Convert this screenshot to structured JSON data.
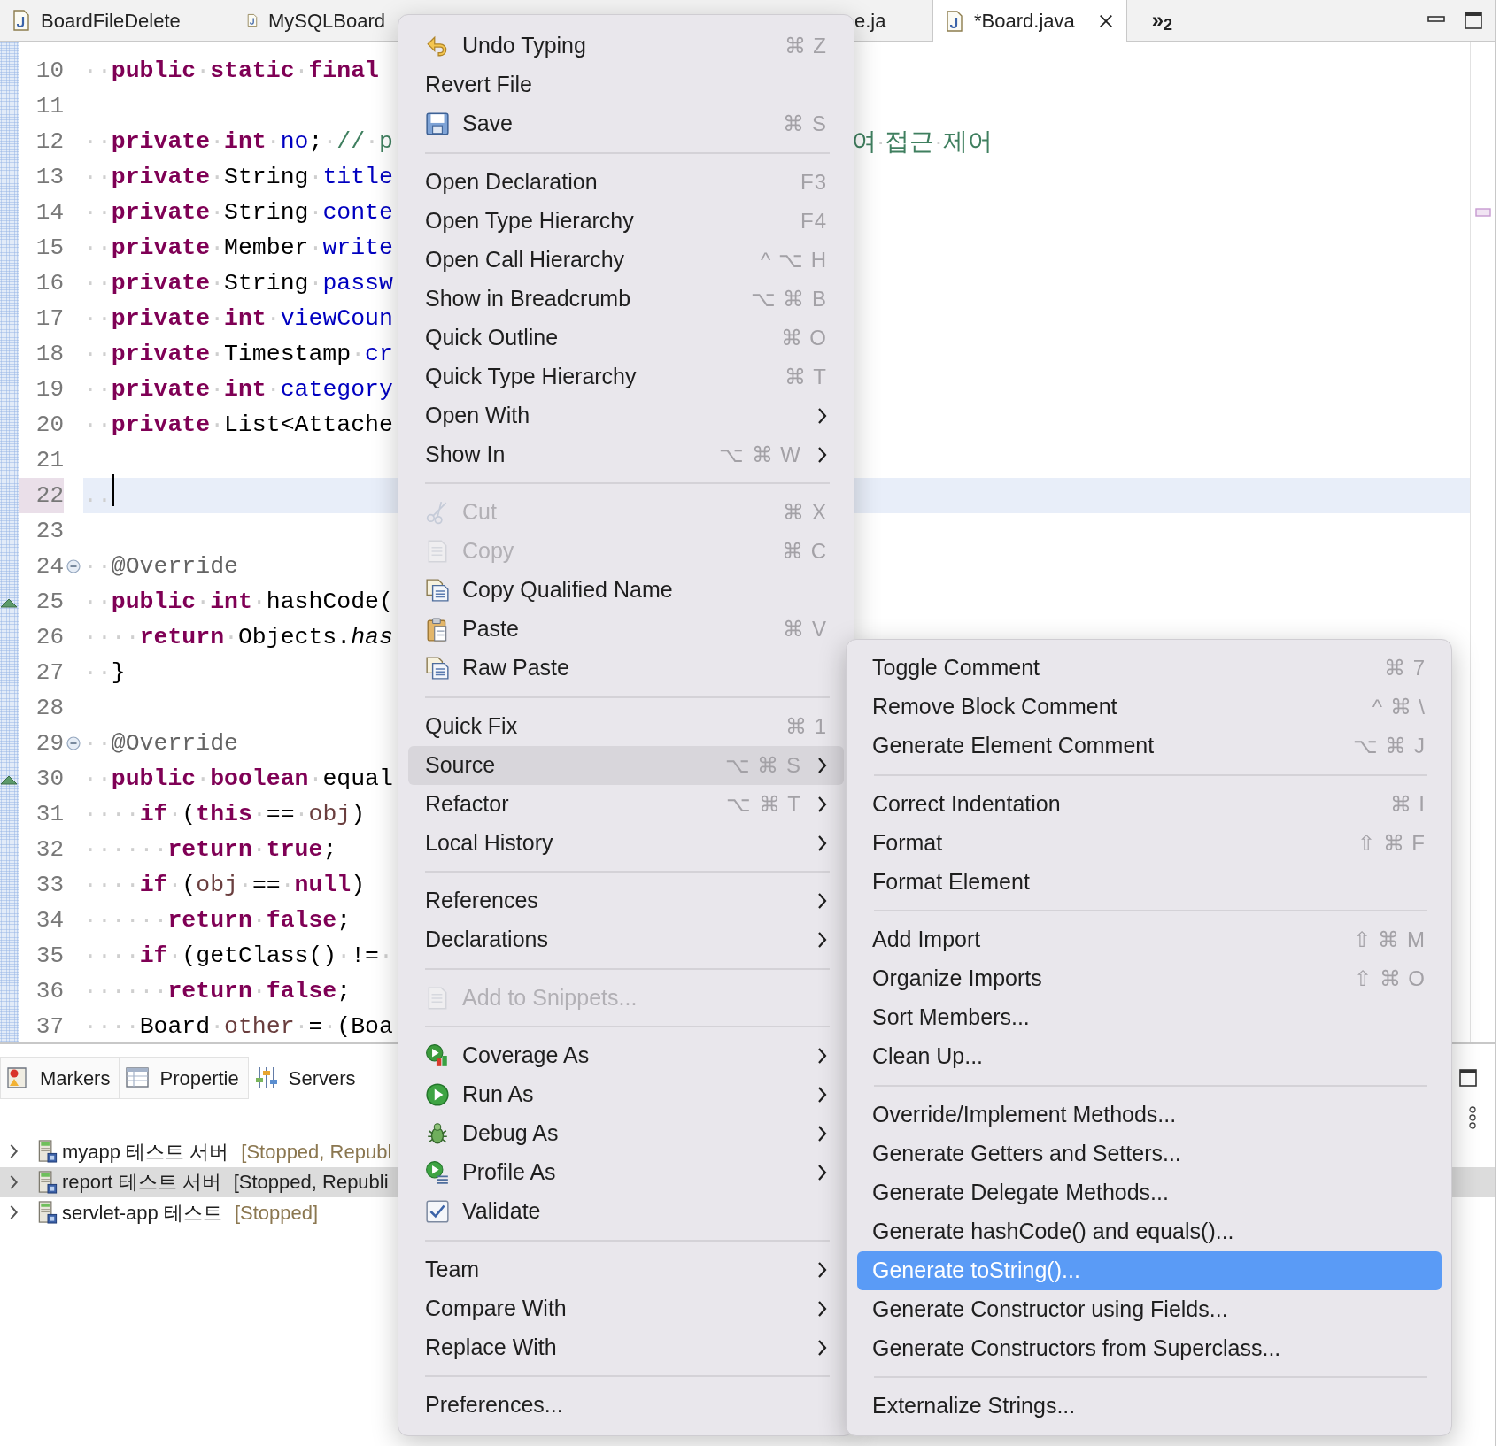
{
  "editor_tabs": [
    {
      "label": "BoardFileDelete",
      "selected": false
    },
    {
      "label": "MySQLBoard",
      "selected": false
    },
    {
      "label": "e.ja",
      "selected": false
    },
    {
      "label": "*Board.java",
      "selected": true
    }
  ],
  "tab_overflow": "»$_{2}$",
  "code_lines": [
    {
      "n": "10",
      "current": false,
      "fold": false,
      "override": false,
      "code": [
        {
          "kind": "kw",
          "text": "··public·static·final"
        }
      ]
    },
    {
      "n": "11",
      "current": false,
      "fold": false,
      "override": false
    },
    {
      "n": "12",
      "current": false,
      "fold": false,
      "override": false,
      "code": [
        {
          "kind": "kw",
          "text": "··private·int·"
        },
        {
          "kind": "field",
          "text": "no"
        },
        {
          "kind": "plain",
          "text": ";·"
        },
        {
          "kind": "comment",
          "text": "//·p"
        }
      ],
      "tail": "여·접근·제어"
    },
    {
      "n": "13",
      "current": false,
      "fold": false,
      "override": false,
      "code": [
        {
          "kind": "kw",
          "text": "··private·"
        },
        {
          "kind": "plain",
          "text": "String·"
        },
        {
          "kind": "field",
          "text": "title"
        }
      ]
    },
    {
      "n": "14",
      "current": false,
      "fold": false,
      "override": false,
      "code": [
        {
          "kind": "kw",
          "text": "··private·"
        },
        {
          "kind": "plain",
          "text": "String·"
        },
        {
          "kind": "field",
          "text": "conte"
        }
      ]
    },
    {
      "n": "15",
      "current": false,
      "fold": false,
      "override": false,
      "code": [
        {
          "kind": "kw",
          "text": "··private·"
        },
        {
          "kind": "plain",
          "text": "Member·"
        },
        {
          "kind": "field",
          "text": "write"
        }
      ]
    },
    {
      "n": "16",
      "current": false,
      "fold": false,
      "override": false,
      "code": [
        {
          "kind": "kw",
          "text": "··private·"
        },
        {
          "kind": "plain",
          "text": "String·"
        },
        {
          "kind": "field",
          "text": "passw"
        }
      ]
    },
    {
      "n": "17",
      "current": false,
      "fold": false,
      "override": false,
      "code": [
        {
          "kind": "kw",
          "text": "··private·int·"
        },
        {
          "kind": "field",
          "text": "viewCoun"
        }
      ]
    },
    {
      "n": "18",
      "current": false,
      "fold": false,
      "override": false,
      "code": [
        {
          "kind": "kw",
          "text": "··private·"
        },
        {
          "kind": "plain",
          "text": "Timestamp·"
        },
        {
          "kind": "field",
          "text": "cr"
        }
      ]
    },
    {
      "n": "19",
      "current": false,
      "fold": false,
      "override": false,
      "code": [
        {
          "kind": "kw",
          "text": "··private·int·"
        },
        {
          "kind": "field",
          "text": "category"
        }
      ]
    },
    {
      "n": "20",
      "current": false,
      "fold": false,
      "override": false,
      "code": [
        {
          "kind": "kw",
          "text": "··private·"
        },
        {
          "kind": "plain",
          "text": "List<Attache"
        }
      ]
    },
    {
      "n": "21",
      "current": false,
      "fold": false,
      "override": false
    },
    {
      "n": "22",
      "current": true,
      "fold": false,
      "override": false,
      "code": [
        {
          "kind": "plain",
          "text": "··"
        }
      ]
    },
    {
      "n": "23",
      "current": false,
      "fold": false,
      "override": false
    },
    {
      "n": "24",
      "current": false,
      "fold": true,
      "override": false,
      "code": [
        {
          "kind": "annotation",
          "text": "··@Override"
        }
      ]
    },
    {
      "n": "25",
      "current": false,
      "fold": false,
      "override": true,
      "code": [
        {
          "kind": "kw",
          "text": "··public·int·"
        },
        {
          "kind": "plain",
          "text": "hashCode("
        }
      ]
    },
    {
      "n": "26",
      "current": false,
      "fold": false,
      "override": false,
      "code": [
        {
          "kind": "kw",
          "text": "····return·"
        },
        {
          "kind": "plain",
          "text": "Objects."
        },
        {
          "kind": "italic",
          "text": "has"
        }
      ]
    },
    {
      "n": "27",
      "current": false,
      "fold": false,
      "override": false,
      "code": [
        {
          "kind": "plain",
          "text": "··}"
        }
      ]
    },
    {
      "n": "28",
      "current": false,
      "fold": false,
      "override": false
    },
    {
      "n": "29",
      "current": false,
      "fold": true,
      "override": false,
      "code": [
        {
          "kind": "annotation",
          "text": "··@Override"
        }
      ]
    },
    {
      "n": "30",
      "current": false,
      "fold": false,
      "override": true,
      "code": [
        {
          "kind": "kw",
          "text": "··public·boolean·"
        },
        {
          "kind": "plain",
          "text": "equal"
        }
      ]
    },
    {
      "n": "31",
      "current": false,
      "fold": false,
      "override": false,
      "code": [
        {
          "kind": "kw",
          "text": "····if·"
        },
        {
          "kind": "plain",
          "text": "("
        },
        {
          "kind": "kw",
          "text": "this"
        },
        {
          "kind": "plain",
          "text": "·==·"
        },
        {
          "kind": "local",
          "text": "obj"
        },
        {
          "kind": "plain",
          "text": ")"
        }
      ]
    },
    {
      "n": "32",
      "current": false,
      "fold": false,
      "override": false,
      "code": [
        {
          "kind": "kw",
          "text": "······return·true"
        },
        {
          "kind": "plain",
          "text": ";"
        }
      ]
    },
    {
      "n": "33",
      "current": false,
      "fold": false,
      "override": false,
      "code": [
        {
          "kind": "kw",
          "text": "····if·"
        },
        {
          "kind": "plain",
          "text": "("
        },
        {
          "kind": "local",
          "text": "obj"
        },
        {
          "kind": "plain",
          "text": "·==·"
        },
        {
          "kind": "kw",
          "text": "null"
        },
        {
          "kind": "plain",
          "text": ")"
        }
      ]
    },
    {
      "n": "34",
      "current": false,
      "fold": false,
      "override": false,
      "code": [
        {
          "kind": "kw",
          "text": "······return·false"
        },
        {
          "kind": "plain",
          "text": ";"
        }
      ]
    },
    {
      "n": "35",
      "current": false,
      "fold": false,
      "override": false,
      "code": [
        {
          "kind": "kw",
          "text": "····if·"
        },
        {
          "kind": "plain",
          "text": "(getClass()·!=·"
        }
      ]
    },
    {
      "n": "36",
      "current": false,
      "fold": false,
      "override": false,
      "code": [
        {
          "kind": "kw",
          "text": "······return·false"
        },
        {
          "kind": "plain",
          "text": ";"
        }
      ]
    },
    {
      "n": "37",
      "current": false,
      "fold": false,
      "override": false,
      "code": [
        {
          "kind": "plain",
          "text": "····Board·"
        },
        {
          "kind": "local",
          "text": "other"
        },
        {
          "kind": "plain",
          "text": "·=·(Boa"
        }
      ]
    }
  ],
  "bottom_panel": {
    "tabs": [
      {
        "label": "Markers",
        "selected": false
      },
      {
        "label": "Propertie",
        "selected": false
      },
      {
        "label": "Servers",
        "selected": true
      }
    ],
    "servers": [
      {
        "name": "myapp 테스트 서버",
        "status": "[Stopped, Republ",
        "selected": false
      },
      {
        "name": "report 테스트 서버",
        "status": "[Stopped, Republi",
        "selected": true
      },
      {
        "name": "servlet-app 테스트",
        "status": "[Stopped]",
        "selected": false
      }
    ]
  },
  "context_menu": {
    "entries": [
      {
        "kind": "item",
        "label": "Undo Typing",
        "shortcut": "⌘ Z",
        "submenu": false,
        "disabled": false,
        "selected": false
      },
      {
        "kind": "item",
        "label": "Revert File",
        "submenu": false,
        "disabled": false,
        "selected": false
      },
      {
        "kind": "item",
        "label": "Save",
        "shortcut": "⌘ S",
        "submenu": false,
        "disabled": false,
        "selected": false
      },
      {
        "kind": "separator"
      },
      {
        "kind": "item",
        "label": "Open Declaration",
        "shortcut": "F3",
        "submenu": false,
        "disabled": false,
        "selected": false
      },
      {
        "kind": "item",
        "label": "Open Type Hierarchy",
        "shortcut": "F4",
        "submenu": false,
        "disabled": false,
        "selected": false
      },
      {
        "kind": "item",
        "label": "Open Call Hierarchy",
        "shortcut": "^ ⌥ H",
        "submenu": false,
        "disabled": false,
        "selected": false
      },
      {
        "kind": "item",
        "label": "Show in Breadcrumb",
        "shortcut": "⌥ ⌘ B",
        "submenu": false,
        "disabled": false,
        "selected": false
      },
      {
        "kind": "item",
        "label": "Quick Outline",
        "shortcut": "⌘ O",
        "submenu": false,
        "disabled": false,
        "selected": false
      },
      {
        "kind": "item",
        "label": "Quick Type Hierarchy",
        "shortcut": "⌘ T",
        "submenu": false,
        "disabled": false,
        "selected": false
      },
      {
        "kind": "item",
        "label": "Open With",
        "submenu": true,
        "disabled": false,
        "selected": false
      },
      {
        "kind": "item",
        "label": "Show In",
        "shortcut": "⌥ ⌘ W",
        "submenu": true,
        "disabled": false,
        "selected": false
      },
      {
        "kind": "separator"
      },
      {
        "kind": "item",
        "label": "Cut",
        "shortcut": "⌘ X",
        "submenu": false,
        "disabled": true,
        "selected": false
      },
      {
        "kind": "item",
        "label": "Copy",
        "shortcut": "⌘ C",
        "submenu": false,
        "disabled": true,
        "selected": false
      },
      {
        "kind": "item",
        "label": "Copy Qualified Name",
        "submenu": false,
        "disabled": false,
        "selected": false
      },
      {
        "kind": "item",
        "label": "Paste",
        "shortcut": "⌘ V",
        "submenu": false,
        "disabled": false,
        "selected": false
      },
      {
        "kind": "item",
        "label": "Raw Paste",
        "submenu": false,
        "disabled": false,
        "selected": false
      },
      {
        "kind": "separator"
      },
      {
        "kind": "item",
        "label": "Quick Fix",
        "shortcut": "⌘ 1",
        "submenu": false,
        "disabled": false,
        "selected": false
      },
      {
        "kind": "item",
        "label": "Source",
        "shortcut": "⌥ ⌘ S",
        "submenu": true,
        "disabled": false,
        "selected": true
      },
      {
        "kind": "item",
        "label": "Refactor",
        "shortcut": "⌥ ⌘ T",
        "submenu": true,
        "disabled": false,
        "selected": false
      },
      {
        "kind": "item",
        "label": "Local History",
        "submenu": true,
        "disabled": false,
        "selected": false
      },
      {
        "kind": "separator"
      },
      {
        "kind": "item",
        "label": "References",
        "submenu": true,
        "disabled": false,
        "selected": false
      },
      {
        "kind": "item",
        "label": "Declarations",
        "submenu": true,
        "disabled": false,
        "selected": false
      },
      {
        "kind": "separator"
      },
      {
        "kind": "item",
        "label": "Add to Snippets...",
        "submenu": false,
        "disabled": true,
        "selected": false
      },
      {
        "kind": "separator"
      },
      {
        "kind": "item",
        "label": "Coverage As",
        "submenu": true,
        "disabled": false,
        "selected": false
      },
      {
        "kind": "item",
        "label": "Run As",
        "submenu": true,
        "disabled": false,
        "selected": false
      },
      {
        "kind": "item",
        "label": "Debug As",
        "submenu": true,
        "disabled": false,
        "selected": false
      },
      {
        "kind": "item",
        "label": "Profile As",
        "submenu": true,
        "disabled": false,
        "selected": false
      },
      {
        "kind": "item",
        "label": "Validate",
        "submenu": false,
        "disabled": false,
        "selected": false
      },
      {
        "kind": "separator"
      },
      {
        "kind": "item",
        "label": "Team",
        "submenu": true,
        "disabled": false,
        "selected": false
      },
      {
        "kind": "item",
        "label": "Compare With",
        "submenu": true,
        "disabled": false,
        "selected": false
      },
      {
        "kind": "item",
        "label": "Replace With",
        "submenu": true,
        "disabled": false,
        "selected": false
      },
      {
        "kind": "separator"
      },
      {
        "kind": "item",
        "label": "Preferences...",
        "submenu": false,
        "disabled": false,
        "selected": false
      }
    ]
  },
  "source_submenu": {
    "entries": [
      {
        "kind": "item",
        "label": "Toggle Comment",
        "shortcut": "⌘ 7",
        "selected": false
      },
      {
        "kind": "item",
        "label": "Remove Block Comment",
        "shortcut": "^ ⌘ \\",
        "selected": false
      },
      {
        "kind": "item",
        "label": "Generate Element Comment",
        "shortcut": "⌥ ⌘ J",
        "selected": false
      },
      {
        "kind": "separator"
      },
      {
        "kind": "item",
        "label": "Correct Indentation",
        "shortcut": "⌘ I",
        "selected": false
      },
      {
        "kind": "item",
        "label": "Format",
        "shortcut": "⇧ ⌘ F",
        "selected": false
      },
      {
        "kind": "item",
        "label": "Format Element",
        "selected": false
      },
      {
        "kind": "separator"
      },
      {
        "kind": "item",
        "label": "Add Import",
        "shortcut": "⇧ ⌘ M",
        "selected": false
      },
      {
        "kind": "item",
        "label": "Organize Imports",
        "shortcut": "⇧ ⌘ O",
        "selected": false
      },
      {
        "kind": "item",
        "label": "Sort Members...",
        "selected": false
      },
      {
        "kind": "item",
        "label": "Clean Up...",
        "selected": false
      },
      {
        "kind": "separator"
      },
      {
        "kind": "item",
        "label": "Override/Implement Methods...",
        "selected": false
      },
      {
        "kind": "item",
        "label": "Generate Getters and Setters...",
        "selected": false
      },
      {
        "kind": "item",
        "label": "Generate Delegate Methods...",
        "selected": false
      },
      {
        "kind": "item",
        "label": "Generate hashCode() and equals()...",
        "selected": false
      },
      {
        "kind": "item",
        "label": "Generate toString()...",
        "selected": true
      },
      {
        "kind": "item",
        "label": "Generate Constructor using Fields...",
        "selected": false
      },
      {
        "kind": "item",
        "label": "Generate Constructors from Superclass...",
        "selected": false
      },
      {
        "kind": "separator"
      },
      {
        "kind": "item",
        "label": "Externalize Strings...",
        "selected": false
      }
    ]
  }
}
